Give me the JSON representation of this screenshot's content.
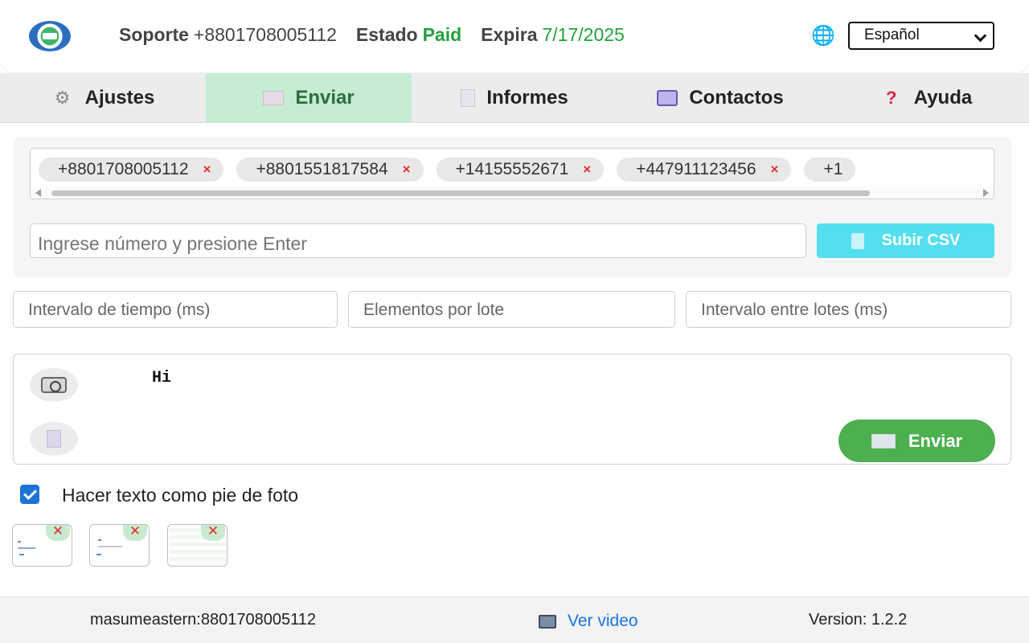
{
  "header": {
    "support_label": "Soporte",
    "support_number": "+8801708005112",
    "status_label": "Estado",
    "status_value": "Paid",
    "expiry_label": "Expira",
    "expiry_date": "7/17/2025",
    "language_selected": "Español",
    "colors": {
      "paid": "#21a03c"
    }
  },
  "tabs": [
    {
      "label": "Ajustes",
      "icon": "gear-icon",
      "active": false
    },
    {
      "label": "Enviar",
      "icon": "envelope-icon",
      "active": true
    },
    {
      "label": "Informes",
      "icon": "document-icon",
      "active": false
    },
    {
      "label": "Contactos",
      "icon": "contacts-icon",
      "active": false
    },
    {
      "label": "Ayuda",
      "icon": "question-icon",
      "active": false
    }
  ],
  "numbers": {
    "chips": [
      "+8801708005112",
      "+8801551817584",
      "+14155552671",
      "+447911123456",
      "+1"
    ],
    "remove_glyph": "×",
    "input_placeholder": "Ingrese número y presione Enter",
    "csv_button": "Subir CSV"
  },
  "settings": {
    "interval_placeholder": "Intervalo de tiempo (ms)",
    "batch_placeholder": "Elementos por lote",
    "batch_interval_placeholder": "Intervalo entre lotes (ms)"
  },
  "message": {
    "text": "Hi",
    "send_button": "Enviar"
  },
  "caption": {
    "checked": true,
    "label": "Hacer texto como pie de foto"
  },
  "attachments": {
    "remove_glyph": "✕"
  },
  "footer": {
    "user": "masumeastern:8801708005112",
    "video_link": "Ver video",
    "version": "Version: 1.2.2"
  },
  "colors": {
    "active_tab_bg": "#c6ecd2",
    "csv_button": "#53dff0",
    "send_button": "#4caf50",
    "link": "#1a73e8"
  }
}
